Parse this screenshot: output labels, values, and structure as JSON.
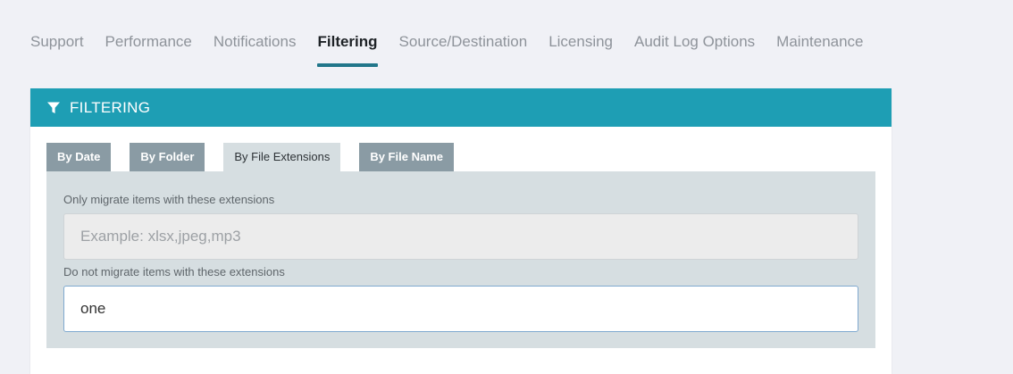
{
  "nav": {
    "tabs": [
      {
        "label": "Support",
        "active": false
      },
      {
        "label": "Performance",
        "active": false
      },
      {
        "label": "Notifications",
        "active": false
      },
      {
        "label": "Filtering",
        "active": true
      },
      {
        "label": "Source/Destination",
        "active": false
      },
      {
        "label": "Licensing",
        "active": false
      },
      {
        "label": "Audit Log Options",
        "active": false
      },
      {
        "label": "Maintenance",
        "active": false
      }
    ],
    "accent_color": "#21768a"
  },
  "card": {
    "icon": "filter-icon",
    "title": "FILTERING",
    "header_color": "#1e9eb4",
    "tabs": [
      {
        "label": "By Date",
        "active": false
      },
      {
        "label": "By Folder",
        "active": false
      },
      {
        "label": "By File Extensions",
        "active": true
      },
      {
        "label": "By File Name",
        "active": false
      }
    ]
  },
  "extensions": {
    "include_label": "Only migrate items with these extensions",
    "include_value": "",
    "include_placeholder": "Example: xlsx,jpeg,mp3",
    "exclude_label": "Do not migrate items with these extensions",
    "exclude_value": "one",
    "exclude_placeholder": ""
  }
}
